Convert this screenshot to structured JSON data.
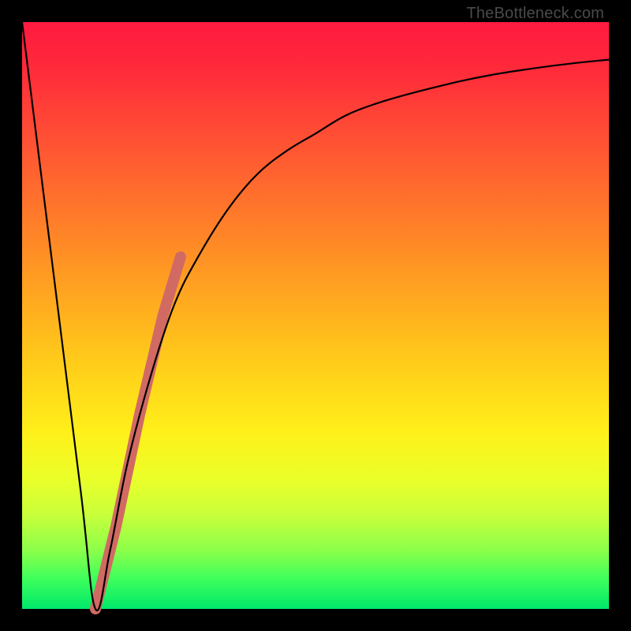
{
  "watermark": "TheBottleneck.com",
  "colors": {
    "frame": "#000000",
    "curve": "#000000",
    "band": "#d16a63"
  },
  "chart_data": {
    "type": "line",
    "title": "",
    "xlabel": "",
    "ylabel": "",
    "xlim": [
      0,
      100
    ],
    "ylim": [
      0,
      100
    ],
    "grid": false,
    "legend": false,
    "series": [
      {
        "name": "bottleneck-curve",
        "x": [
          0,
          5,
          10,
          12.5,
          15,
          18,
          22,
          26,
          30,
          35,
          40,
          45,
          50,
          55,
          60,
          65,
          70,
          75,
          80,
          85,
          90,
          95,
          100
        ],
        "values": [
          100,
          60,
          20,
          0,
          10,
          25,
          40,
          52,
          60,
          68,
          74,
          78,
          81,
          84,
          86,
          87.5,
          88.8,
          90,
          91,
          91.8,
          92.5,
          93.1,
          93.6
        ]
      },
      {
        "name": "highlight-band",
        "x": [
          12.5,
          16,
          20,
          24,
          27
        ],
        "values": [
          0,
          14,
          33,
          50,
          60
        ]
      }
    ]
  }
}
